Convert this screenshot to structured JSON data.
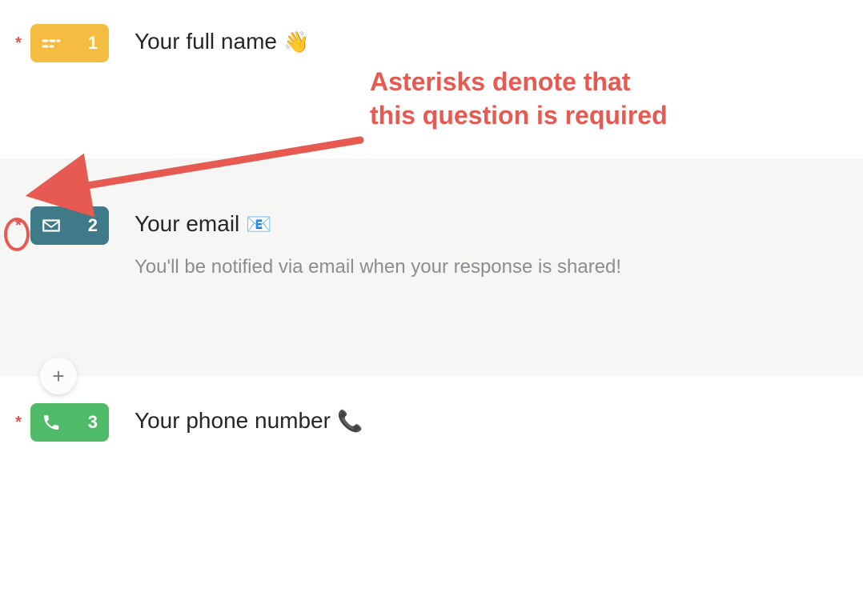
{
  "annotation": {
    "text_line1": "Asterisks denote that",
    "text_line2": "this question is required"
  },
  "colors": {
    "accent_red": "#e65a51",
    "badge_yellow": "#f5bc42",
    "badge_teal": "#3e7a88",
    "badge_green": "#4fbb68"
  },
  "questions": [
    {
      "required_mark": "*",
      "number": "1",
      "icon": "short-text-icon",
      "badge_color": "yellow",
      "title": "Your full name",
      "emoji": "👋",
      "description": ""
    },
    {
      "required_mark": "*",
      "number": "2",
      "icon": "email-icon",
      "badge_color": "teal",
      "title": "Your email",
      "emoji": "📧",
      "description": "You'll be notified via email when your response is shared!"
    },
    {
      "required_mark": "*",
      "number": "3",
      "icon": "phone-icon",
      "badge_color": "green",
      "title": "Your phone number",
      "emoji": "📞",
      "description": ""
    }
  ],
  "add_button_label": "+"
}
